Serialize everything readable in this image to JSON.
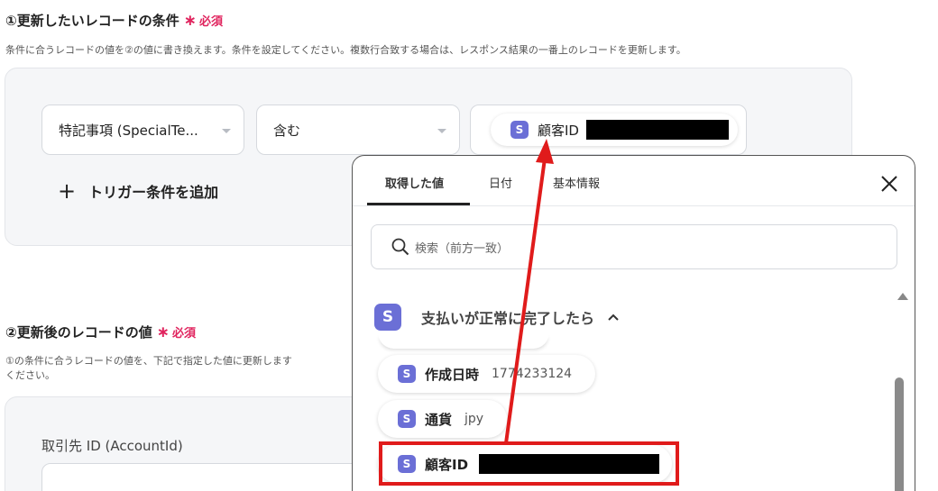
{
  "section1": {
    "title": "①更新したいレコードの条件",
    "star": "∗",
    "required": "必須",
    "description": "条件に合うレコードの値を②の値に書き換えます。条件を設定してください。複数行合致する場合は、レスポンス結果の一番上のレコードを更新します。"
  },
  "condition": {
    "field_value": "特記事項 (SpecialTe...",
    "operator_value": "含む",
    "value_chip_badge": "S",
    "value_chip_label": "顧客ID",
    "add_label": "トリガー条件を追加"
  },
  "section2": {
    "title": "②更新後のレコードの値",
    "star": "∗",
    "required": "必須",
    "description_line1": "①の条件に合うレコードの値を、下記で指定した値に更新します",
    "description_line2": "ください。",
    "field_label": "取引先 ID (AccountId)"
  },
  "popup": {
    "tabs": [
      "取得した値",
      "日付",
      "基本情報"
    ],
    "active_tab": "取得した値",
    "search_placeholder": "検索（前方一致）",
    "group_badge": "S",
    "group_label": "支払いが正常に完了したら",
    "items": [
      {
        "badge": "S",
        "label": "作成日時",
        "value": "1774233124"
      },
      {
        "badge": "S",
        "label": "通貨",
        "value": "jpy"
      },
      {
        "badge": "S",
        "label": "顧客ID",
        "value": ""
      }
    ]
  },
  "colors": {
    "accent": "#6b6fd6",
    "required": "#e0245e",
    "annotation": "#e01b1b"
  }
}
